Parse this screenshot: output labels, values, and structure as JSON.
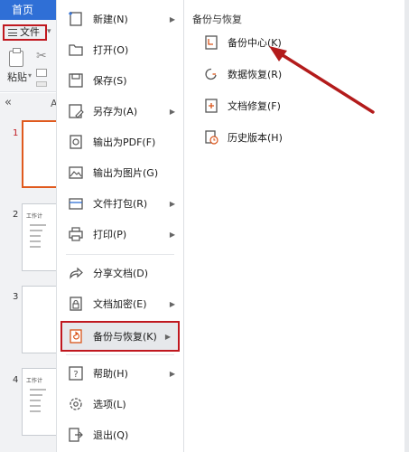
{
  "tabbar": {
    "home_tab": "首页"
  },
  "toolbar": {
    "file_label": "文件",
    "paste_label": "粘贴"
  },
  "slide_panel": {
    "slides": [
      {
        "number": "1",
        "title": ""
      },
      {
        "number": "2",
        "title": "工作计"
      },
      {
        "number": "3",
        "title": ""
      },
      {
        "number": "4",
        "title": "工作计"
      }
    ],
    "top_label": "A"
  },
  "file_menu": {
    "items": [
      {
        "label": "新建(N)",
        "icon": "new-file-icon",
        "has_submenu": true
      },
      {
        "label": "打开(O)",
        "icon": "folder-open-icon",
        "has_submenu": false
      },
      {
        "label": "保存(S)",
        "icon": "save-icon",
        "has_submenu": false
      },
      {
        "label": "另存为(A)",
        "icon": "save-as-icon",
        "has_submenu": true
      },
      {
        "label": "输出为PDF(F)",
        "icon": "pdf-icon",
        "has_submenu": false
      },
      {
        "label": "输出为图片(G)",
        "icon": "image-icon",
        "has_submenu": false
      },
      {
        "label": "文件打包(R)",
        "icon": "package-icon",
        "has_submenu": true
      },
      {
        "label": "打印(P)",
        "icon": "print-icon",
        "has_submenu": true
      },
      {
        "label": "分享文档(D)",
        "icon": "share-icon",
        "has_submenu": false
      },
      {
        "label": "文档加密(E)",
        "icon": "lock-icon",
        "has_submenu": true
      },
      {
        "label": "备份与恢复(K)",
        "icon": "backup-icon",
        "has_submenu": true
      },
      {
        "label": "帮助(H)",
        "icon": "help-icon",
        "has_submenu": true
      },
      {
        "label": "选项(L)",
        "icon": "gear-icon",
        "has_submenu": false
      },
      {
        "label": "退出(Q)",
        "icon": "exit-icon",
        "has_submenu": false
      }
    ]
  },
  "backup_submenu": {
    "title": "备份与恢复",
    "items": [
      {
        "label": "备份中心(K)",
        "icon": "backup-center-icon"
      },
      {
        "label": "数据恢复(R)",
        "icon": "data-recovery-icon"
      },
      {
        "label": "文档修复(F)",
        "icon": "doc-repair-icon"
      },
      {
        "label": "历史版本(H)",
        "icon": "history-icon"
      }
    ]
  },
  "colors": {
    "tab_blue": "#2f6fd6",
    "highlight_red": "#c0181f",
    "annotation_arrow": "#b31b1b",
    "icon_orange": "#d9541a"
  }
}
